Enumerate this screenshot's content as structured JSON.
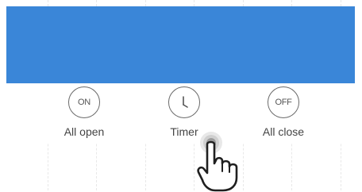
{
  "banner": {
    "color": "#3a86d8"
  },
  "actions": [
    {
      "icon_text": "ON",
      "icon": "on-icon",
      "label": "All open"
    },
    {
      "icon_text": "",
      "icon": "clock-icon",
      "label": "Timer"
    },
    {
      "icon_text": "OFF",
      "icon": "off-icon",
      "label": "All close"
    }
  ],
  "overlay": {
    "icon": "pointing-hand-icon"
  }
}
